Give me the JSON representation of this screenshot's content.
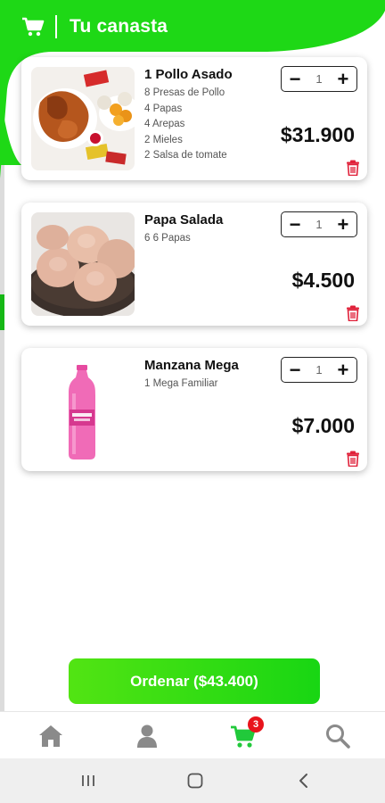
{
  "header": {
    "title": "Tu canasta"
  },
  "items": [
    {
      "name": "1 Pollo Asado",
      "details": [
        "8 Presas de Pollo",
        "4 Papas",
        "4 Arepas",
        "2 Mieles",
        "2 Salsa de tomate"
      ],
      "quantity": "1",
      "price": "$31.900"
    },
    {
      "name": "Papa Salada",
      "details": [
        "6 6 Papas"
      ],
      "quantity": "1",
      "price": "$4.500"
    },
    {
      "name": "Manzana Mega",
      "details": [
        "1 Mega Familiar"
      ],
      "quantity": "1",
      "price": "$7.000"
    }
  ],
  "qty_controls": {
    "minus": "−",
    "plus": "+"
  },
  "order_button": {
    "label": "Ordenar ($43.400)"
  },
  "bottom_nav": {
    "items": [
      {
        "icon": "home-icon",
        "active": false
      },
      {
        "icon": "user-icon",
        "active": false
      },
      {
        "icon": "cart-icon",
        "active": true
      },
      {
        "icon": "search-icon",
        "active": false
      }
    ],
    "cart_badge": "3"
  },
  "colors": {
    "brand_green": "#1ed816",
    "active_green": "#21c93b",
    "inactive_gray": "#8a8a8a",
    "badge_red": "#e8141c",
    "trash_red": "#e0213a"
  }
}
